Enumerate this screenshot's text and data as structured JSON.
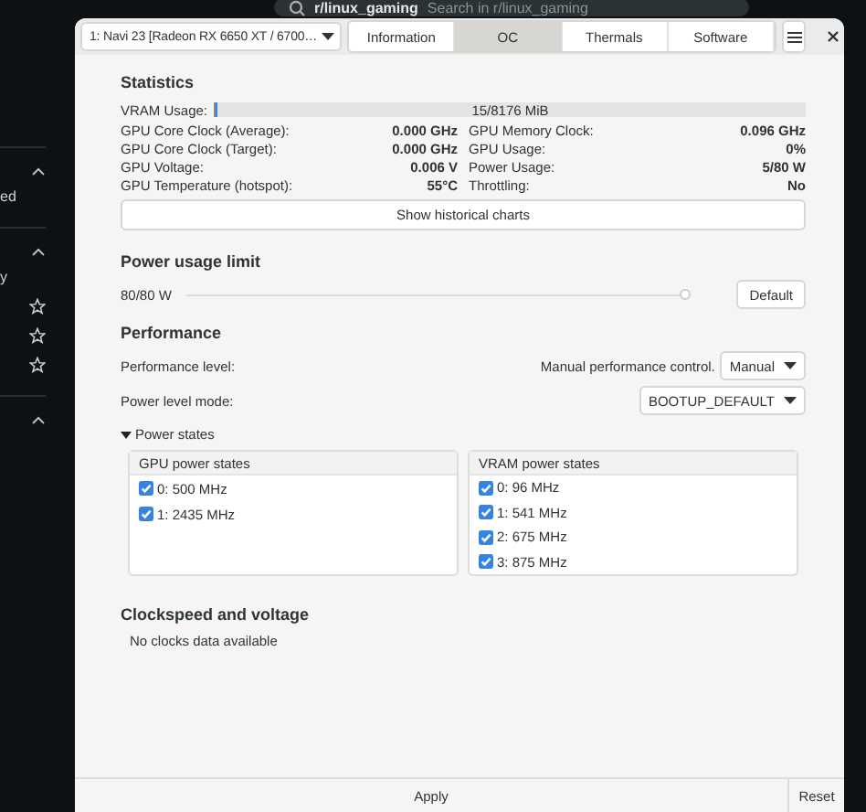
{
  "background": {
    "community": "r/linux_gaming",
    "search_placeholder": "Search in r/linux_gaming",
    "sidebar_texts": [
      "ed",
      "y"
    ]
  },
  "window": {
    "gpu_select": "1: Navi 23 [Radeon RX 6650 XT / 6700…",
    "tabs": [
      {
        "label": "Information",
        "selected": false
      },
      {
        "label": "OC",
        "selected": true
      },
      {
        "label": "Thermals",
        "selected": false
      },
      {
        "label": "Software",
        "selected": false
      }
    ],
    "statistics": {
      "title": "Statistics",
      "vram": {
        "label": "VRAM Usage:",
        "reading": "15/8176 MiB",
        "level": 0.002
      },
      "items": [
        {
          "label": "GPU Core Clock (Average):",
          "value": "0.000 GHz"
        },
        {
          "label": "GPU Memory Clock:",
          "value": "0.096 GHz"
        },
        {
          "label": "GPU Core Clock (Target):",
          "value": "0.000 GHz"
        },
        {
          "label": "GPU Usage:",
          "value": "0%"
        },
        {
          "label": "GPU Voltage:",
          "value": "0.006 V"
        },
        {
          "label": "Power Usage:",
          "value": "5/80 W"
        },
        {
          "label": "GPU Temperature (hotspot):",
          "value": "55°C"
        },
        {
          "label": "Throttling:",
          "value": "No"
        }
      ],
      "charts_button": "Show historical charts"
    },
    "power_limit": {
      "title": "Power usage limit",
      "reading": "80/80 W",
      "level": 1,
      "button": "Default"
    },
    "performance": {
      "title": "Performance",
      "level_label": "Performance level:",
      "manual_label": "Manual performance control.",
      "level_value": "Manual",
      "mode_label": "Power level mode:",
      "mode_value": "BOOTUP_DEFAULT"
    },
    "power_states": {
      "title": "Power states",
      "expanded": true,
      "lists": [
        {
          "title": "GPU power states",
          "states": [
            {
              "label": "0: 500 MHz",
              "checked": true
            },
            {
              "label": "1: 2435 MHz",
              "checked": true
            }
          ]
        },
        {
          "title": "VRAM power states",
          "states": [
            {
              "label": "0: 96 MHz",
              "checked": true
            },
            {
              "label": "1: 541 MHz",
              "checked": true
            },
            {
              "label": "2: 675 MHz",
              "checked": true
            },
            {
              "label": "3: 875 MHz",
              "checked": true
            }
          ]
        }
      ]
    },
    "clocks": {
      "title": "Clockspeed and voltage",
      "message": "No clocks data available"
    },
    "apply": "Apply",
    "reset": "Reset"
  }
}
